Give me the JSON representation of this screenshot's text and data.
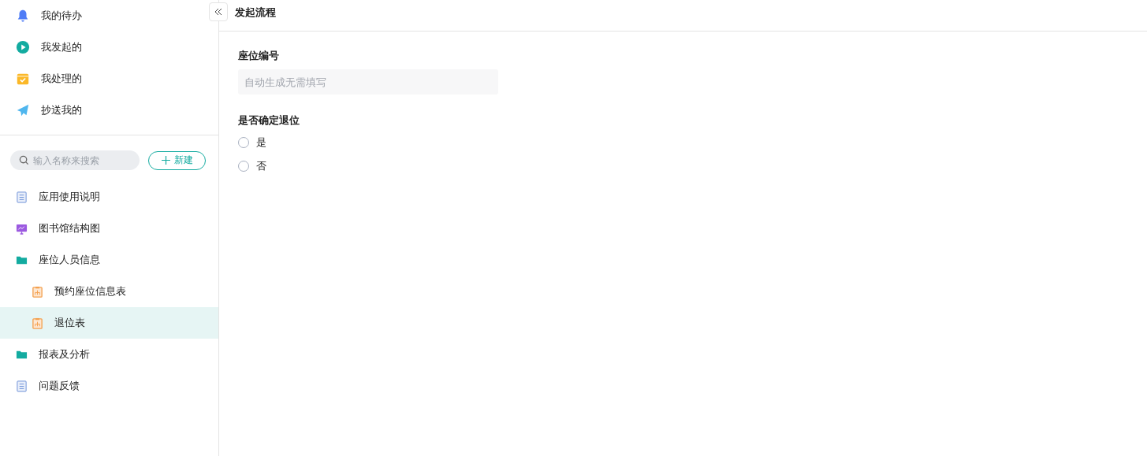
{
  "sidebar": {
    "nav": [
      {
        "label": "我的待办",
        "kind": "bell"
      },
      {
        "label": "我发起的",
        "kind": "play"
      },
      {
        "label": "我处理的",
        "kind": "tray"
      },
      {
        "label": "抄送我的",
        "kind": "plane"
      }
    ],
    "search": {
      "placeholder": "输入名称来搜索"
    },
    "new_button": "新建",
    "tree": [
      {
        "label": "应用使用说明",
        "kind": "doc",
        "selected": false
      },
      {
        "label": "图书馆结构图",
        "kind": "chart",
        "selected": false
      },
      {
        "label": "座位人员信息",
        "kind": "folder",
        "selected": false,
        "children": [
          {
            "label": "预约座位信息表",
            "kind": "form",
            "selected": false
          },
          {
            "label": "退位表",
            "kind": "form",
            "selected": true
          }
        ]
      },
      {
        "label": "报表及分析",
        "kind": "folder",
        "selected": false
      },
      {
        "label": "问题反馈",
        "kind": "doc",
        "selected": false
      }
    ]
  },
  "header": {
    "title": "发起流程"
  },
  "form": {
    "fields": [
      {
        "kind": "text",
        "label": "座位编号",
        "placeholder": "自动生成无需填写"
      },
      {
        "kind": "radio",
        "label": "是否确定退位",
        "options": [
          {
            "label": "是",
            "selected": false
          },
          {
            "label": "否",
            "selected": false
          }
        ]
      }
    ]
  }
}
